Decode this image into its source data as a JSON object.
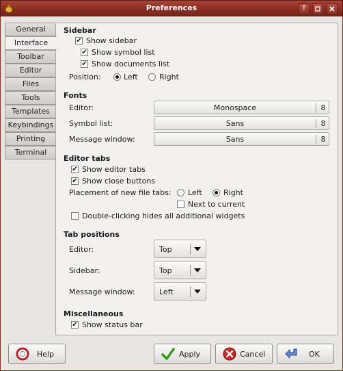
{
  "window": {
    "title": "Preferences"
  },
  "tabs": [
    "General",
    "Interface",
    "Toolbar",
    "Editor",
    "Files",
    "Tools",
    "Templates",
    "Keybindings",
    "Printing",
    "Terminal"
  ],
  "active_tab": "Interface",
  "sidebar": {
    "title": "Sidebar",
    "show_sidebar": "Show sidebar",
    "show_symbol_list": "Show symbol list",
    "show_documents_list": "Show documents list",
    "position_label": "Position:",
    "position_left": "Left",
    "position_right": "Right",
    "position_selected": "Left"
  },
  "fonts": {
    "title": "Fonts",
    "editor_label": "Editor:",
    "editor_font": "Monospace",
    "editor_size": "8",
    "symbol_label": "Symbol list:",
    "symbol_font": "Sans",
    "symbol_size": "8",
    "message_label": "Message window:",
    "message_font": "Sans",
    "message_size": "8"
  },
  "editor_tabs": {
    "title": "Editor tabs",
    "show_editor_tabs": "Show editor tabs",
    "show_close_buttons": "Show close buttons",
    "placement_label": "Placement of new file tabs:",
    "placement_left": "Left",
    "placement_right": "Right",
    "placement_selected": "Right",
    "next_to_current": "Next to current",
    "double_click": "Double-clicking hides all additional widgets"
  },
  "tab_positions": {
    "title": "Tab positions",
    "editor_label": "Editor:",
    "editor_value": "Top",
    "sidebar_label": "Sidebar:",
    "sidebar_value": "Top",
    "message_label": "Message window:",
    "message_value": "Left"
  },
  "misc": {
    "title": "Miscellaneous",
    "show_status_bar": "Show status bar"
  },
  "buttons": {
    "help": "Help",
    "apply": "Apply",
    "cancel": "Cancel",
    "ok": "OK"
  }
}
